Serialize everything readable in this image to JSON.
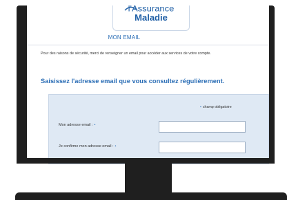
{
  "logo": {
    "line1": "l'Assurance",
    "line2": "Maladie"
  },
  "page": {
    "header": "MON EMAIL",
    "intro": "Pour des raisons de sécurité, merci de renseigner un email pour accéder aux services de votre compte.",
    "heading": "Saisissez l'adresse email que vous consultez régulièrement."
  },
  "form": {
    "required_marker": "•",
    "required_note": "champ obligatoire",
    "fields": [
      {
        "label": "Mon adresse email :",
        "value": ""
      },
      {
        "label": "Je confirme mon adresse email :",
        "value": ""
      }
    ]
  },
  "colors": {
    "accent": "#2a6db5",
    "form_background": "#dfe9f4",
    "monitor": "#1f1f1f"
  }
}
